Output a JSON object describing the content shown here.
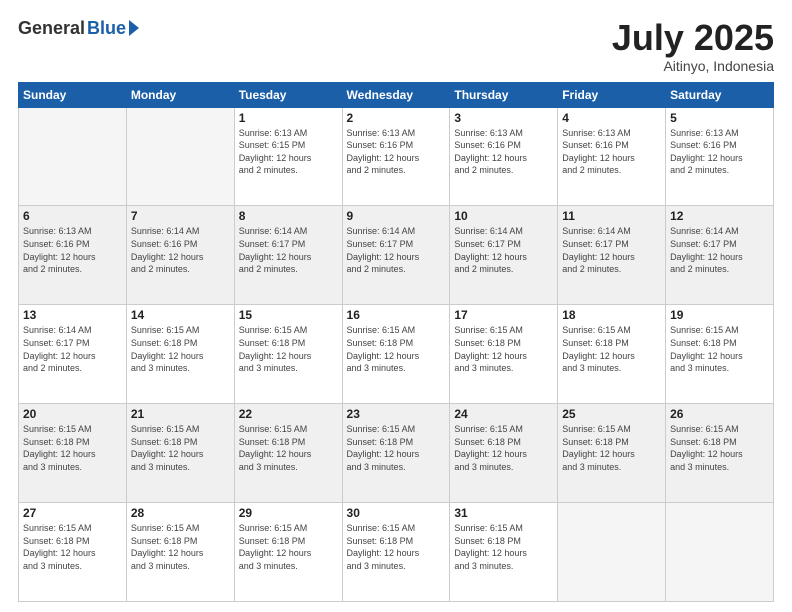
{
  "header": {
    "logo_general": "General",
    "logo_blue": "Blue",
    "month_title": "July 2025",
    "subtitle": "Aitinyo, Indonesia"
  },
  "days_of_week": [
    "Sunday",
    "Monday",
    "Tuesday",
    "Wednesday",
    "Thursday",
    "Friday",
    "Saturday"
  ],
  "weeks": [
    {
      "shade": false,
      "days": [
        {
          "num": "",
          "info": ""
        },
        {
          "num": "",
          "info": ""
        },
        {
          "num": "1",
          "info": "Sunrise: 6:13 AM\nSunset: 6:15 PM\nDaylight: 12 hours\nand 2 minutes."
        },
        {
          "num": "2",
          "info": "Sunrise: 6:13 AM\nSunset: 6:16 PM\nDaylight: 12 hours\nand 2 minutes."
        },
        {
          "num": "3",
          "info": "Sunrise: 6:13 AM\nSunset: 6:16 PM\nDaylight: 12 hours\nand 2 minutes."
        },
        {
          "num": "4",
          "info": "Sunrise: 6:13 AM\nSunset: 6:16 PM\nDaylight: 12 hours\nand 2 minutes."
        },
        {
          "num": "5",
          "info": "Sunrise: 6:13 AM\nSunset: 6:16 PM\nDaylight: 12 hours\nand 2 minutes."
        }
      ]
    },
    {
      "shade": true,
      "days": [
        {
          "num": "6",
          "info": "Sunrise: 6:13 AM\nSunset: 6:16 PM\nDaylight: 12 hours\nand 2 minutes."
        },
        {
          "num": "7",
          "info": "Sunrise: 6:14 AM\nSunset: 6:16 PM\nDaylight: 12 hours\nand 2 minutes."
        },
        {
          "num": "8",
          "info": "Sunrise: 6:14 AM\nSunset: 6:17 PM\nDaylight: 12 hours\nand 2 minutes."
        },
        {
          "num": "9",
          "info": "Sunrise: 6:14 AM\nSunset: 6:17 PM\nDaylight: 12 hours\nand 2 minutes."
        },
        {
          "num": "10",
          "info": "Sunrise: 6:14 AM\nSunset: 6:17 PM\nDaylight: 12 hours\nand 2 minutes."
        },
        {
          "num": "11",
          "info": "Sunrise: 6:14 AM\nSunset: 6:17 PM\nDaylight: 12 hours\nand 2 minutes."
        },
        {
          "num": "12",
          "info": "Sunrise: 6:14 AM\nSunset: 6:17 PM\nDaylight: 12 hours\nand 2 minutes."
        }
      ]
    },
    {
      "shade": false,
      "days": [
        {
          "num": "13",
          "info": "Sunrise: 6:14 AM\nSunset: 6:17 PM\nDaylight: 12 hours\nand 2 minutes."
        },
        {
          "num": "14",
          "info": "Sunrise: 6:15 AM\nSunset: 6:18 PM\nDaylight: 12 hours\nand 3 minutes."
        },
        {
          "num": "15",
          "info": "Sunrise: 6:15 AM\nSunset: 6:18 PM\nDaylight: 12 hours\nand 3 minutes."
        },
        {
          "num": "16",
          "info": "Sunrise: 6:15 AM\nSunset: 6:18 PM\nDaylight: 12 hours\nand 3 minutes."
        },
        {
          "num": "17",
          "info": "Sunrise: 6:15 AM\nSunset: 6:18 PM\nDaylight: 12 hours\nand 3 minutes."
        },
        {
          "num": "18",
          "info": "Sunrise: 6:15 AM\nSunset: 6:18 PM\nDaylight: 12 hours\nand 3 minutes."
        },
        {
          "num": "19",
          "info": "Sunrise: 6:15 AM\nSunset: 6:18 PM\nDaylight: 12 hours\nand 3 minutes."
        }
      ]
    },
    {
      "shade": true,
      "days": [
        {
          "num": "20",
          "info": "Sunrise: 6:15 AM\nSunset: 6:18 PM\nDaylight: 12 hours\nand 3 minutes."
        },
        {
          "num": "21",
          "info": "Sunrise: 6:15 AM\nSunset: 6:18 PM\nDaylight: 12 hours\nand 3 minutes."
        },
        {
          "num": "22",
          "info": "Sunrise: 6:15 AM\nSunset: 6:18 PM\nDaylight: 12 hours\nand 3 minutes."
        },
        {
          "num": "23",
          "info": "Sunrise: 6:15 AM\nSunset: 6:18 PM\nDaylight: 12 hours\nand 3 minutes."
        },
        {
          "num": "24",
          "info": "Sunrise: 6:15 AM\nSunset: 6:18 PM\nDaylight: 12 hours\nand 3 minutes."
        },
        {
          "num": "25",
          "info": "Sunrise: 6:15 AM\nSunset: 6:18 PM\nDaylight: 12 hours\nand 3 minutes."
        },
        {
          "num": "26",
          "info": "Sunrise: 6:15 AM\nSunset: 6:18 PM\nDaylight: 12 hours\nand 3 minutes."
        }
      ]
    },
    {
      "shade": false,
      "days": [
        {
          "num": "27",
          "info": "Sunrise: 6:15 AM\nSunset: 6:18 PM\nDaylight: 12 hours\nand 3 minutes."
        },
        {
          "num": "28",
          "info": "Sunrise: 6:15 AM\nSunset: 6:18 PM\nDaylight: 12 hours\nand 3 minutes."
        },
        {
          "num": "29",
          "info": "Sunrise: 6:15 AM\nSunset: 6:18 PM\nDaylight: 12 hours\nand 3 minutes."
        },
        {
          "num": "30",
          "info": "Sunrise: 6:15 AM\nSunset: 6:18 PM\nDaylight: 12 hours\nand 3 minutes."
        },
        {
          "num": "31",
          "info": "Sunrise: 6:15 AM\nSunset: 6:18 PM\nDaylight: 12 hours\nand 3 minutes."
        },
        {
          "num": "",
          "info": ""
        },
        {
          "num": "",
          "info": ""
        }
      ]
    }
  ]
}
